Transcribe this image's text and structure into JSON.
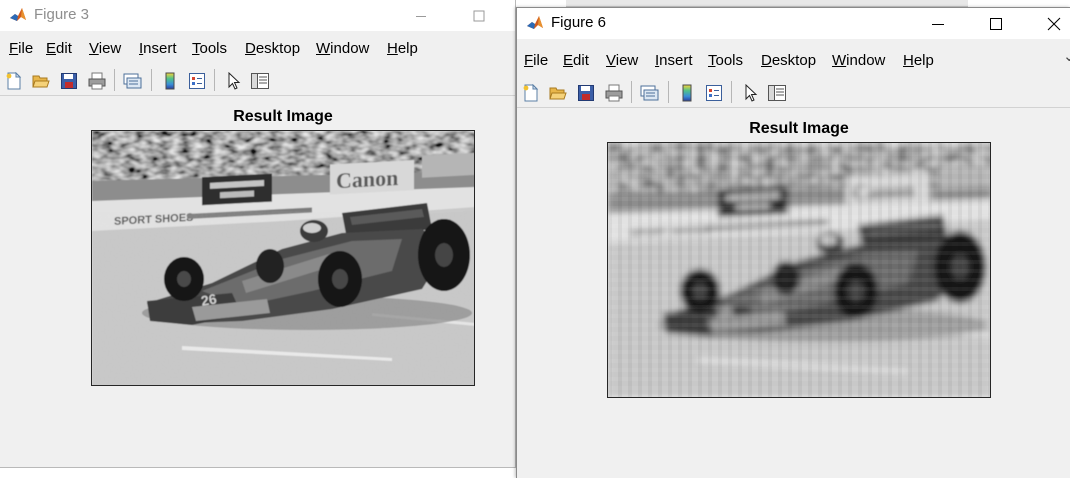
{
  "figure3": {
    "title": "Figure 3",
    "menu": [
      {
        "mn": "F",
        "rest": "ile"
      },
      {
        "mn": "E",
        "rest": "dit"
      },
      {
        "mn": "V",
        "rest": "iew"
      },
      {
        "mn": "I",
        "rest": "nsert"
      },
      {
        "mn": "T",
        "rest": "ools"
      },
      {
        "mn": "D",
        "rest": "esktop"
      },
      {
        "mn": "W",
        "rest": "indow"
      },
      {
        "mn": "H",
        "rest": "elp"
      }
    ],
    "plot_title": "Result Image",
    "image_description_icon": "grayscale-race-car-photo"
  },
  "figure6": {
    "title": "Figure 6",
    "menu": [
      {
        "mn": "F",
        "rest": "ile"
      },
      {
        "mn": "E",
        "rest": "dit"
      },
      {
        "mn": "V",
        "rest": "iew"
      },
      {
        "mn": "I",
        "rest": "nsert"
      },
      {
        "mn": "T",
        "rest": "ools"
      },
      {
        "mn": "D",
        "rest": "esktop"
      },
      {
        "mn": "W",
        "rest": "indow"
      },
      {
        "mn": "H",
        "rest": "elp"
      }
    ],
    "plot_title": "Result Image",
    "image_description_icon": "blurred-grayscale-race-car-photo"
  },
  "toolbar_icons": [
    "new-figure-icon",
    "open-file-icon",
    "save-icon",
    "print-icon",
    "link-plot-icon",
    "insert-colorbar-icon",
    "insert-legend-icon",
    "edit-plot-icon",
    "property-inspector-icon"
  ],
  "colors": {
    "window_bg": "#f0f0f0",
    "titlebar_bg": "#ffffff",
    "inactive_title": "#8e8e8e",
    "active_title": "#000000"
  }
}
